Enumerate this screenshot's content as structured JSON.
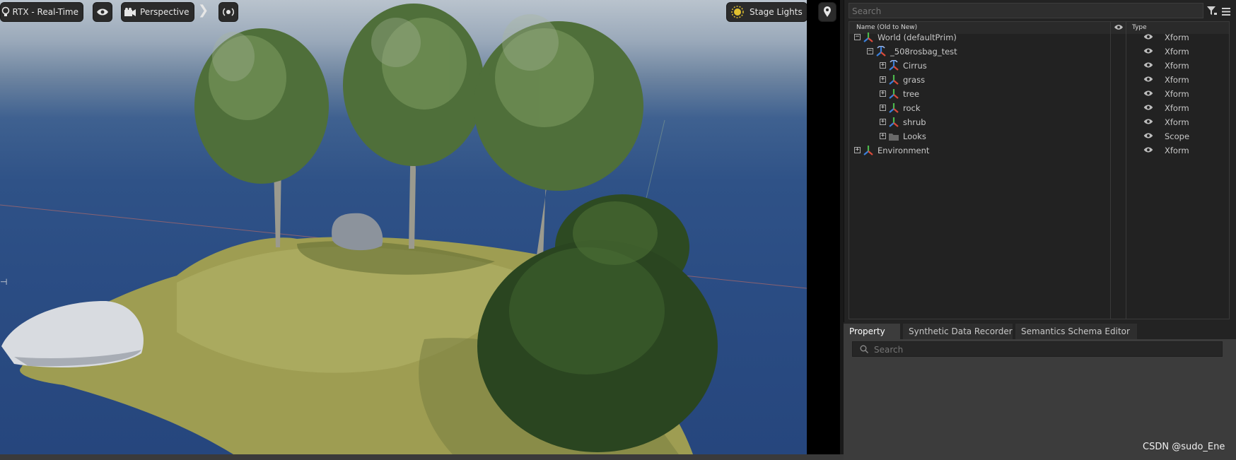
{
  "viewport": {
    "renderer_label": "RTX - Real-Time",
    "camera_label": "Perspective",
    "lights_label": "Stage Lights",
    "icons": [
      "lightbulb-icon",
      "eye-icon",
      "camera-icon",
      "chevron-right-icon",
      "broadcast-icon",
      "sun-icon",
      "pin-icon"
    ]
  },
  "stage": {
    "search_placeholder": "Search",
    "columns": {
      "name": "Name (Old to New)",
      "type": "Type"
    },
    "rows": [
      {
        "name": "World (defaultPrim)",
        "type": "Xform",
        "expander": "−"
      },
      {
        "name": "_508rosbag_test",
        "type": "Xform",
        "expander": "−"
      },
      {
        "name": "Cirrus",
        "type": "Xform",
        "expander": "+"
      },
      {
        "name": "grass",
        "type": "Xform",
        "expander": "+"
      },
      {
        "name": "tree",
        "type": "Xform",
        "expander": "+"
      },
      {
        "name": "rock",
        "type": "Xform",
        "expander": "+"
      },
      {
        "name": "shrub",
        "type": "Xform",
        "expander": "+"
      },
      {
        "name": "Looks",
        "type": "Scope",
        "expander": "+"
      },
      {
        "name": "Environment",
        "type": "Xform",
        "expander": "+"
      }
    ]
  },
  "property": {
    "tabs": [
      "Property",
      "Synthetic Data Recorder",
      "Semantics Schema Editor"
    ],
    "search_placeholder": "Search"
  },
  "watermark": "CSDN @sudo_Ene",
  "colors": {
    "xform_red": "#d94a3a",
    "xform_green": "#4cb84c",
    "xform_blue": "#3b7fd9",
    "panel_bg": "#232323"
  }
}
